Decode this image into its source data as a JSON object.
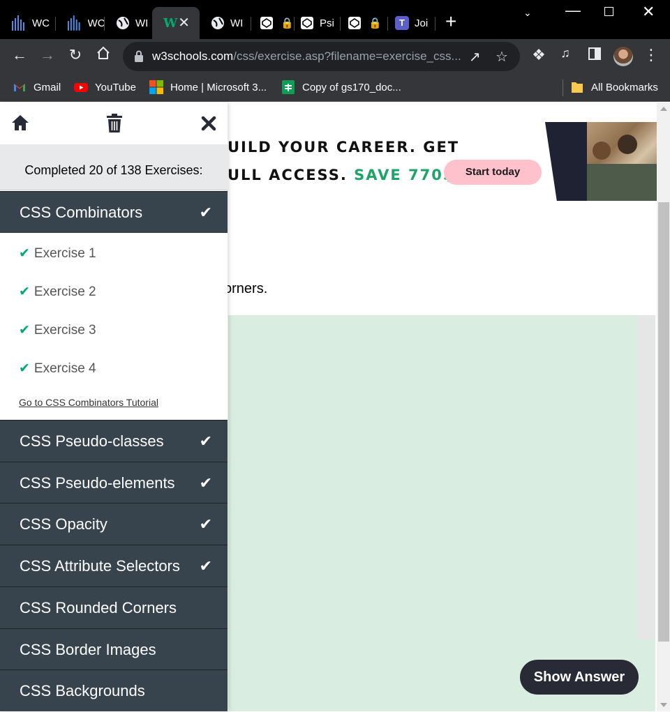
{
  "browser": {
    "tabs": [
      {
        "label": "WC",
        "icon": "bars-icon"
      },
      {
        "label": "WC",
        "icon": "bars-icon"
      },
      {
        "label": "WI",
        "icon": "globe-icon"
      },
      {
        "label": "",
        "icon": "w3schools-icon",
        "active": true
      },
      {
        "label": "WI",
        "icon": "globe-icon"
      },
      {
        "label": "",
        "icon": "codepen-icon",
        "locked": true
      },
      {
        "label": "Psi",
        "icon": "codepen-icon"
      },
      {
        "label": "",
        "icon": "codepen-icon",
        "locked": true
      },
      {
        "label": "Joi",
        "icon": "teams-icon"
      }
    ],
    "url_host": "w3schools.com",
    "url_path": "/css/exercise.asp?filename=exercise_css...",
    "bookmarks": [
      {
        "label": "Gmail",
        "icon": "gmail-icon"
      },
      {
        "label": "YouTube",
        "icon": "youtube-icon"
      },
      {
        "label": "Home | Microsoft 3...",
        "icon": "microsoft-icon"
      },
      {
        "label": "Copy of gs170_doc...",
        "icon": "sheets-icon"
      },
      {
        "label": "All Bookmarks",
        "icon": "folder-icon"
      }
    ]
  },
  "ad": {
    "line1": "UILD YOUR CAREER. GET",
    "line2_prefix": "ULL ACCESS. ",
    "line2_save": "SAVE 770$",
    "button": "Start today"
  },
  "sidebar": {
    "progress": "Completed 20 of 138 Exercises:",
    "active_category": "CSS Combinators",
    "exercises": [
      "Exercise 1",
      "Exercise 2",
      "Exercise 3",
      "Exercise 4"
    ],
    "tutorial_link": "Go to CSS Combinators Tutorial",
    "categories": [
      {
        "label": "CSS Pseudo-classes",
        "done": true
      },
      {
        "label": "CSS Pseudo-elements",
        "done": true
      },
      {
        "label": "CSS Opacity",
        "done": true
      },
      {
        "label": "CSS Attribute Selectors",
        "done": true
      },
      {
        "label": "CSS Rounded Corners",
        "done": false
      },
      {
        "label": "CSS Border Images",
        "done": false
      },
      {
        "label": "CSS Backgrounds",
        "done": false
      }
    ]
  },
  "main": {
    "instruction_tail": "orners.",
    "show_answer": "Show Answer"
  },
  "colors": {
    "accent_green": "#04aa6d",
    "sidebar_dark": "#38444d",
    "code_bg": "#d9ede0",
    "button_dark": "#282a35"
  }
}
